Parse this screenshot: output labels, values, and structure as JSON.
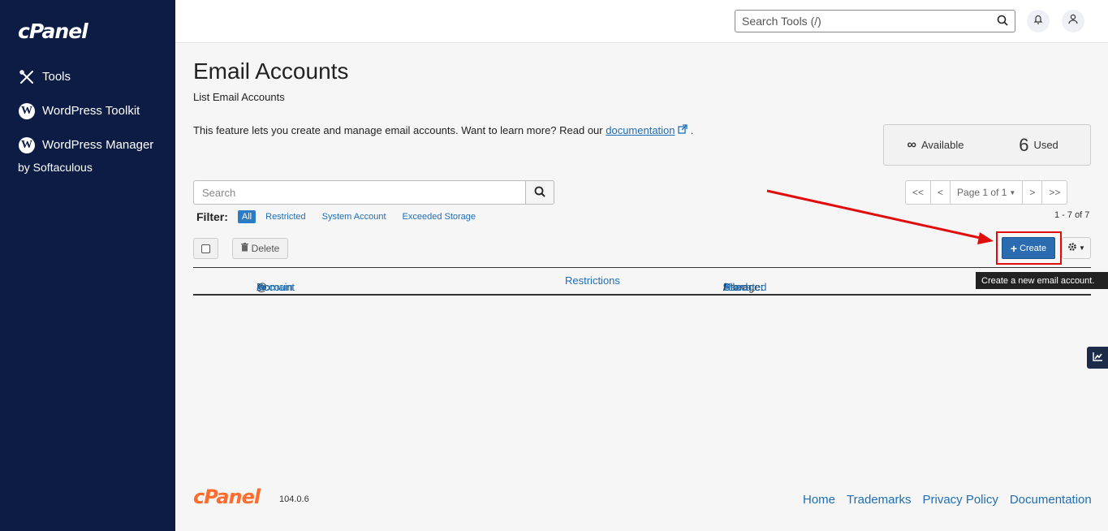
{
  "sidebar": {
    "logo": "cPanel",
    "items": [
      {
        "label": "Tools",
        "icon": "tools-icon"
      },
      {
        "label": "WordPress Toolkit",
        "icon": "wordpress-icon"
      },
      {
        "label": "WordPress Manager",
        "label2": "by Softaculous",
        "icon": "wordpress-icon"
      }
    ]
  },
  "topbar": {
    "search_placeholder": "Search Tools (/)"
  },
  "main": {
    "title": "Email Accounts",
    "subtitle": "List Email Accounts",
    "intro_text": "This feature lets you create and manage email accounts. Want to learn more? Read our ",
    "intro_link": "documentation",
    "intro_end": " .",
    "stats": {
      "available_symbol": "∞",
      "available_label": "Available",
      "used_value": "6",
      "used_label": "Used"
    },
    "search_placeholder": "Search",
    "pager": {
      "first": "<<",
      "prev": "<",
      "page": "Page 1 of 1",
      "next": ">",
      "last": ">>"
    },
    "filter": {
      "label": "Filter:",
      "options": [
        "All",
        "Restricted",
        "System Account",
        "Exceeded Storage"
      ],
      "active": "All"
    },
    "range": "1 - 7 of 7",
    "delete_label": "Delete",
    "create_label": "Create",
    "tooltip": "Create a new email account.",
    "table": {
      "account": "Account",
      "at": "@",
      "domain": "Domain",
      "restrictions": "Restrictions",
      "storage_prefix": "Storage:",
      "used": "Used",
      "slash1": "/",
      "allocated": "Allocated",
      "slash2": "/",
      "percent": "%"
    }
  },
  "footer": {
    "logo": "cPanel",
    "version": "104.0.6",
    "links": [
      "Home",
      "Trademarks",
      "Privacy Policy",
      "Documentation"
    ]
  },
  "colors": {
    "sidebar_bg": "#0c1c45",
    "accent": "#2b6cb0",
    "link": "#1f6eb5",
    "brand_orange": "#ff6c2c",
    "highlight_red": "#e10c0c"
  }
}
